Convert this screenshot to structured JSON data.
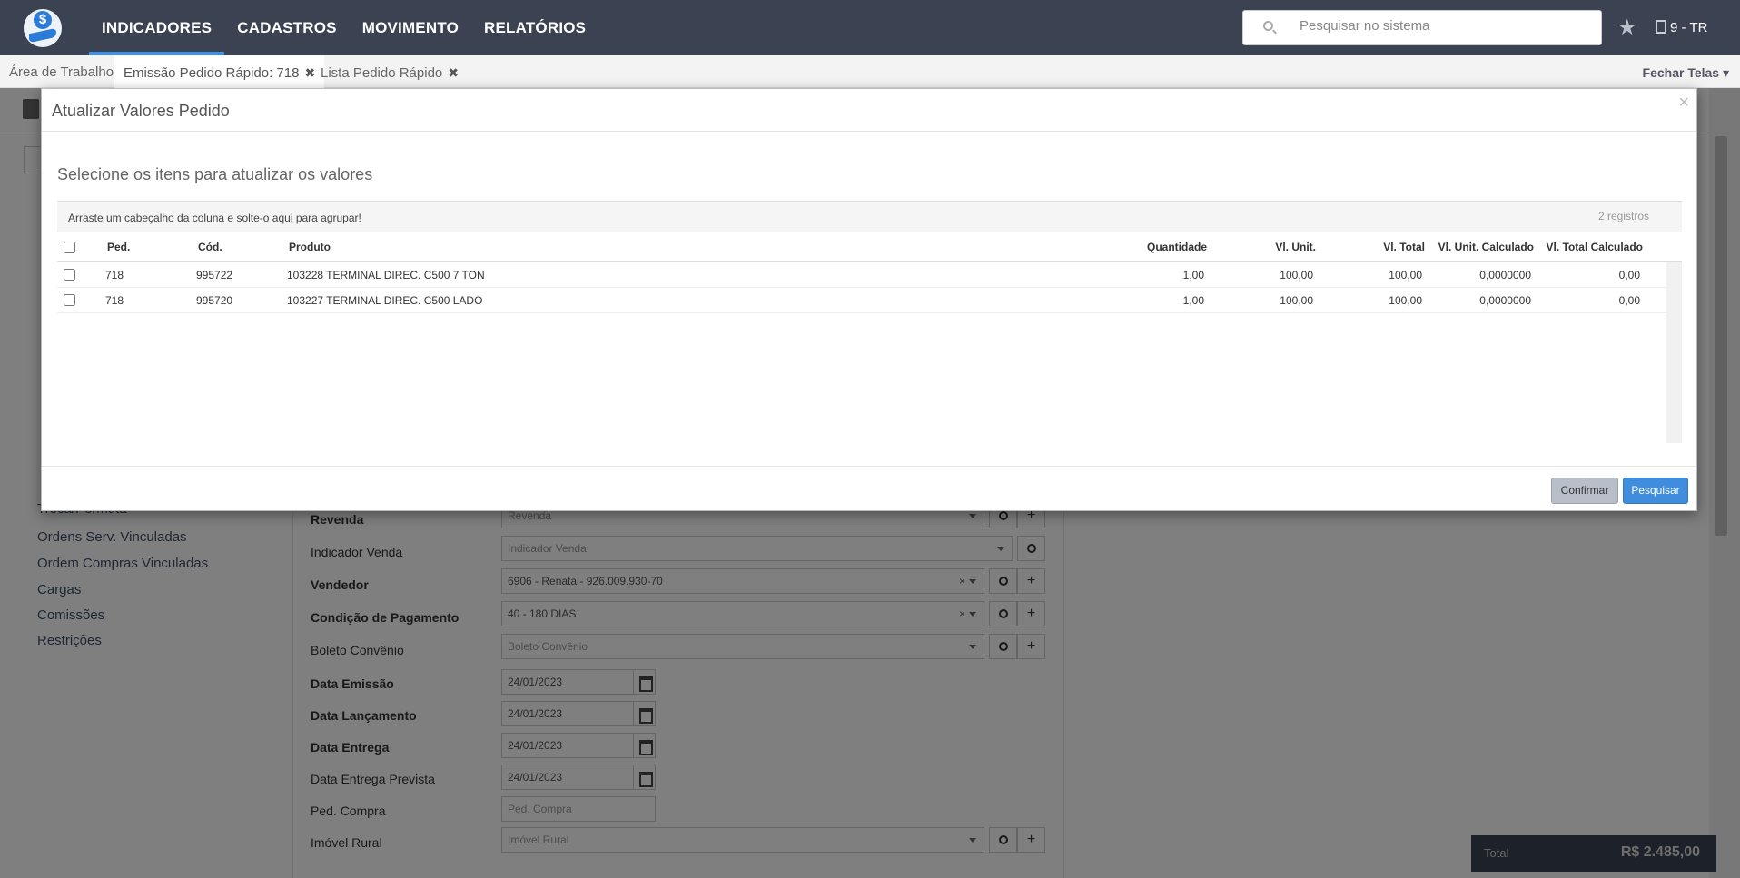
{
  "nav": {
    "items": [
      "INDICADORES",
      "CADASTROS",
      "MOVIMENTO",
      "RELATÓRIOS"
    ],
    "active": "INDICADORES",
    "search_placeholder": "Pesquisar no sistema",
    "company": "9 - TR"
  },
  "tabs": {
    "items": [
      "Área de Trabalho",
      "Emissão Pedido Rápido: 718",
      "Lista Pedido Rápido"
    ],
    "active_index": 1,
    "close_all": "Fechar Telas"
  },
  "left_menu": {
    "items": [
      "Troca/Permuta",
      "Ordens Serv. Vinculadas",
      "Ordem Compras Vinculadas",
      "Cargas",
      "Comissões",
      "Restrições"
    ]
  },
  "form": {
    "revenda": {
      "label": "Revenda",
      "placeholder": "Revenda"
    },
    "indicador_venda": {
      "label": "Indicador Venda",
      "placeholder": "Indicador Venda"
    },
    "vendedor": {
      "label": "Vendedor",
      "value": "6906 - Renata - 926.009.930-70"
    },
    "condicao_pagamento": {
      "label": "Condição de Pagamento",
      "value": "40 - 180 DIAS"
    },
    "boleto_convenio": {
      "label": "Boleto Convênio",
      "placeholder": "Boleto Convênio"
    },
    "data_emissao": {
      "label": "Data Emissão",
      "value": "24/01/2023"
    },
    "data_lancamento": {
      "label": "Data Lançamento",
      "value": "24/01/2023"
    },
    "data_entrega": {
      "label": "Data Entrega",
      "value": "24/01/2023"
    },
    "data_entrega_prevista": {
      "label": "Data Entrega Prevista",
      "value": "24/01/2023"
    },
    "ped_compra": {
      "label": "Ped. Compra",
      "placeholder": "Ped. Compra"
    },
    "imovel_rural": {
      "label": "Imóvel Rural",
      "placeholder": "Imóvel Rural"
    }
  },
  "total": {
    "label": "Total",
    "value": "R$ 2.485,00"
  },
  "modal": {
    "title": "Atualizar Valores Pedido",
    "subtitle": "Selecione os itens para atualizar os valores",
    "group_hint": "Arraste um cabeçalho da coluna e solte-o aqui para agrupar!",
    "record_count": "2 registros",
    "columns": [
      "Ped.",
      "Cód.",
      "Produto",
      "Quantidade",
      "Vl. Unit.",
      "Vl. Total",
      "Vl. Unit. Calculado",
      "Vl. Total Calculado"
    ],
    "rows": [
      {
        "ped": "718",
        "cod": "995722",
        "produto": "103228 TERMINAL DIREC. C500 7 TON",
        "quantidade": "1,00",
        "vl_unit": "100,00",
        "vl_total": "100,00",
        "vl_unit_calc": "0,0000000",
        "vl_total_calc": "0,00"
      },
      {
        "ped": "718",
        "cod": "995720",
        "produto": "103227 TERMINAL DIREC. C500 LADO",
        "quantidade": "1,00",
        "vl_unit": "100,00",
        "vl_total": "100,00",
        "vl_unit_calc": "0,0000000",
        "vl_total_calc": "0,00"
      }
    ],
    "buttons": {
      "confirm": "Confirmar",
      "search": "Pesquisar"
    }
  }
}
